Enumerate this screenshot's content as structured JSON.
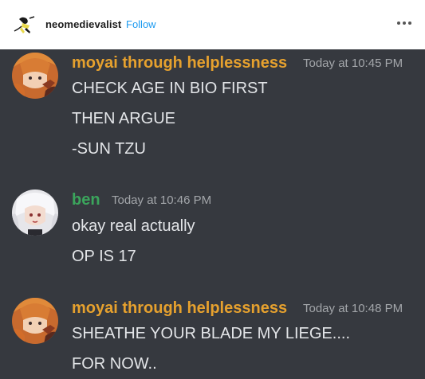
{
  "post": {
    "username": "neomedievalist",
    "follow_label": "Follow"
  },
  "colors": {
    "chat_background": "#36393f",
    "username_gold": "#e6a12e",
    "username_green": "#3ba55c",
    "timestamp": "#a3a6aa",
    "message_text": "#e3e5e8",
    "follow_blue": "#1d9bf0"
  },
  "messages": [
    {
      "author": "moyai through helplessness",
      "time": "Today at 10:45 PM",
      "lines": [
        "CHECK AGE IN BIO FIRST",
        "THEN ARGUE",
        "-SUN TZU"
      ]
    },
    {
      "author": "ben",
      "time": "Today at 10:46 PM",
      "lines": [
        "okay real actually",
        "OP IS 17"
      ]
    },
    {
      "author": "moyai through helplessness",
      "time": "Today at 10:48 PM",
      "lines": [
        "SHEATHE YOUR BLADE MY LIEGE....",
        "FOR NOW.."
      ]
    }
  ]
}
